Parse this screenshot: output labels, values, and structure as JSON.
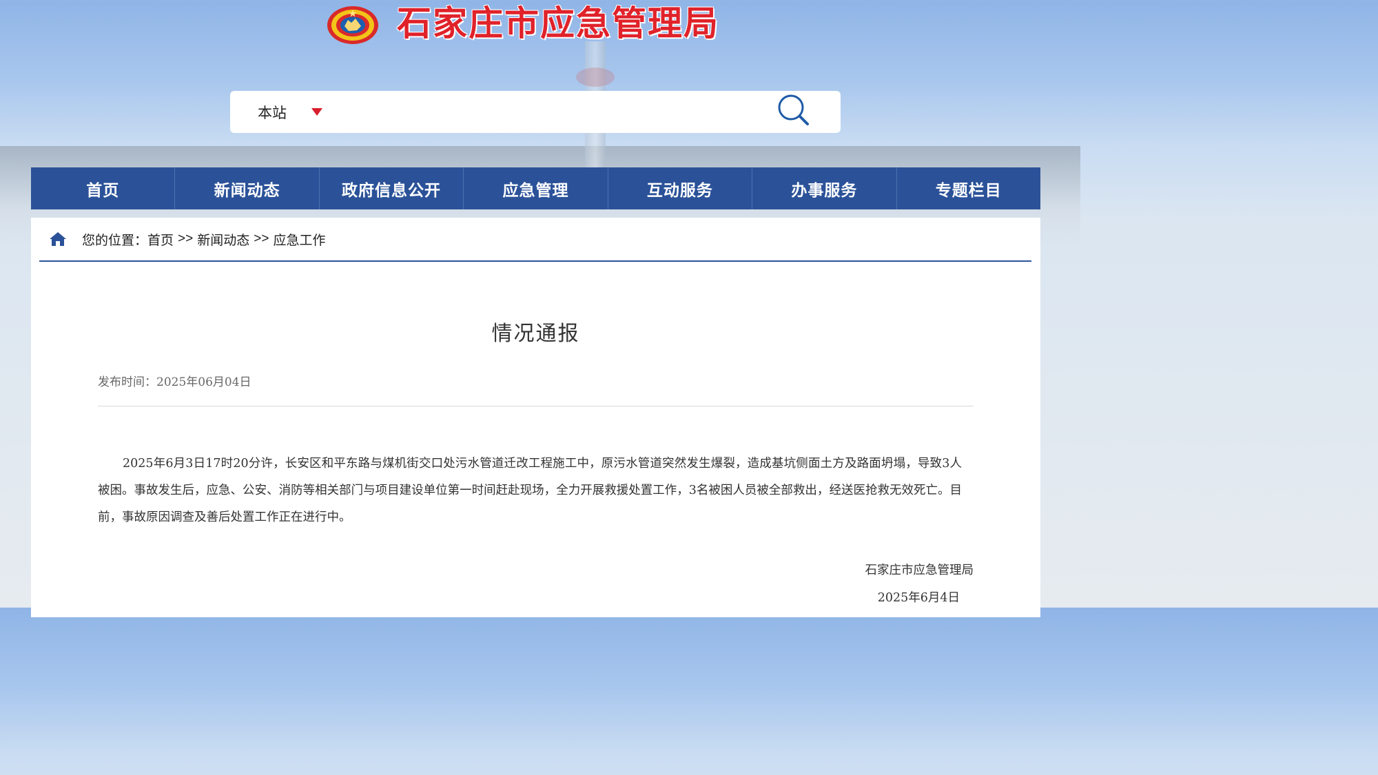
{
  "header": {
    "site_title": "石家庄市应急管理局",
    "logo": "emergency-management-emblem"
  },
  "search": {
    "scope_label": "本站",
    "placeholder": "",
    "icon": "search-icon",
    "scope_arrow_color": "#d91d2c"
  },
  "nav": {
    "items": [
      {
        "label": "首页"
      },
      {
        "label": "新闻动态"
      },
      {
        "label": "政府信息公开"
      },
      {
        "label": "应急管理"
      },
      {
        "label": "互动服务"
      },
      {
        "label": "办事服务"
      },
      {
        "label": "专题栏目"
      }
    ],
    "bg_color": "#2b5299"
  },
  "breadcrumb": {
    "icon": "home-icon",
    "prefix": "您的位置：",
    "items": [
      "首页",
      "新闻动态",
      "应急工作"
    ],
    "separator": ">>"
  },
  "article": {
    "title": "情况通报",
    "publish_time": "发布时间：2025年06月04日",
    "body": "2025年6月3日17时20分许，长安区和平东路与煤机街交口处污水管道迁改工程施工中，原污水管道突然发生爆裂，造成基坑侧面土方及路面坍塌，导致3人被困。事故发生后，应急、公安、消防等相关部门与项目建设单位第一时间赶赴现场，全力开展救援处置工作，3名被困人员被全部救出，经送医抢救无效死亡。目前，事故原因调查及善后处置工作正在进行中。",
    "signature_org": "石家庄市应急管理局",
    "signature_date": "2025年6月4日"
  },
  "colors": {
    "title_red": "#e0222a",
    "nav_blue": "#2b5299"
  }
}
